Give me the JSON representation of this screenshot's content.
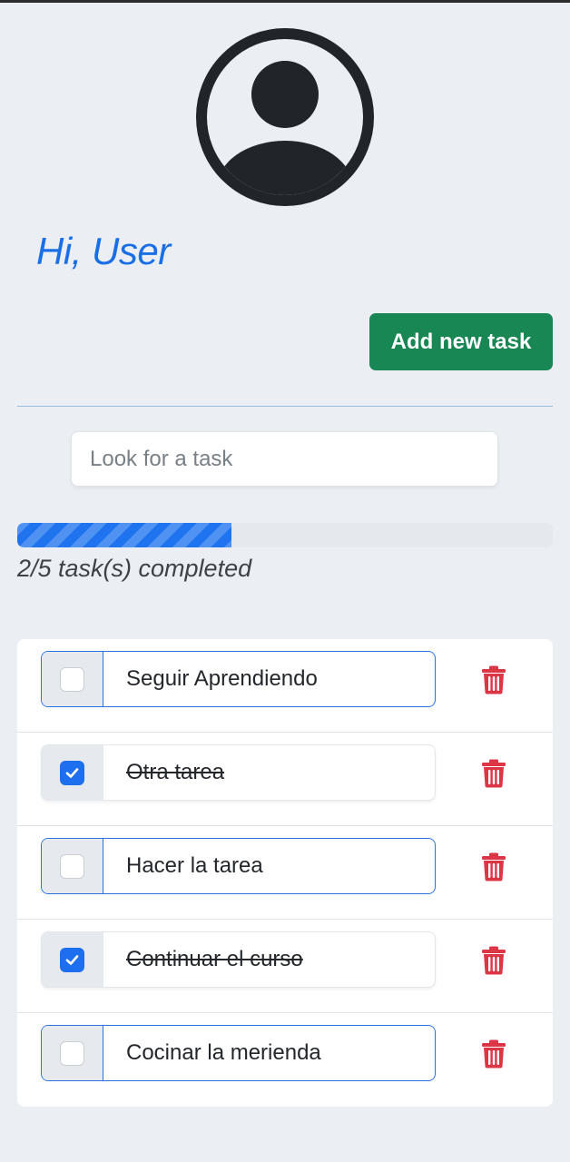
{
  "header": {
    "avatar_icon": "user-circle-icon",
    "greeting": "Hi, User"
  },
  "toolbar": {
    "add_label": "Add new task",
    "add_color": "#198754"
  },
  "search": {
    "placeholder": "Look for a task",
    "value": ""
  },
  "progress": {
    "completed": 2,
    "total": 5,
    "fraction": 0.4,
    "label": "2/5 task(s) completed",
    "color": "#1f73ee"
  },
  "tasks": [
    {
      "text": "Seguir Aprendiendo",
      "done": false
    },
    {
      "text": "Otra tarea ",
      "done": true
    },
    {
      "text": "Hacer la tarea",
      "done": false
    },
    {
      "text": "Continuar el curso ",
      "done": true
    },
    {
      "text": "Cocinar la merienda",
      "done": false
    }
  ],
  "icons": {
    "delete": "trash-icon",
    "check": "check-icon",
    "delete_color": "#dc3545"
  }
}
